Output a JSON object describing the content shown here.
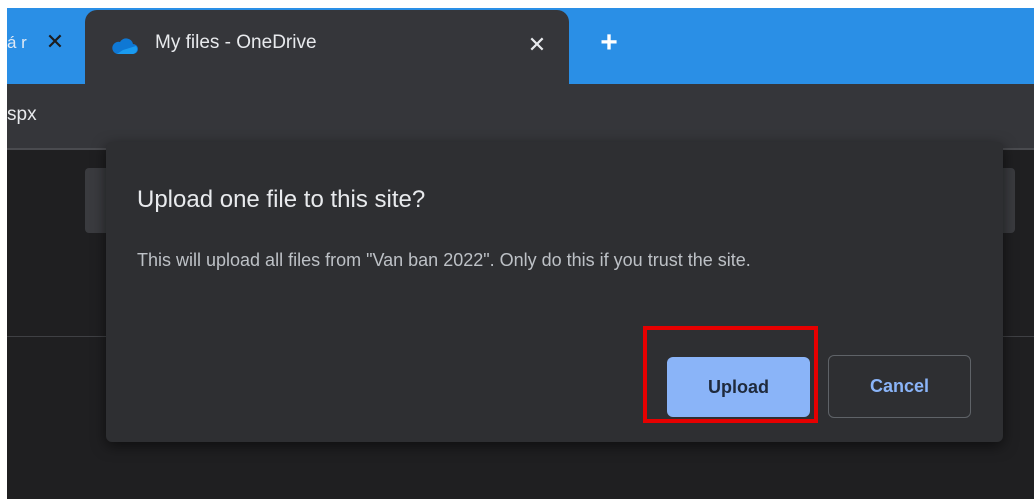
{
  "browser": {
    "previous_tab": {
      "title_fragment": "á r",
      "close_icon": "close-icon"
    },
    "active_tab": {
      "title": "My files - OneDrive",
      "icon": "onedrive-cloud-icon",
      "close_icon": "close-icon"
    },
    "new_tab_icon": "plus-icon",
    "address_fragment": "spx"
  },
  "dialog": {
    "title": "Upload one file to this site?",
    "message": "This will upload all files from \"Van ban 2022\". Only do this if you trust the site.",
    "upload_label": "Upload",
    "cancel_label": "Cancel"
  },
  "colors": {
    "tab_strip": "#2a8fe6",
    "dialog_bg": "#2e2f32",
    "primary_button": "#8ab4f8",
    "highlight": "#e60000"
  }
}
